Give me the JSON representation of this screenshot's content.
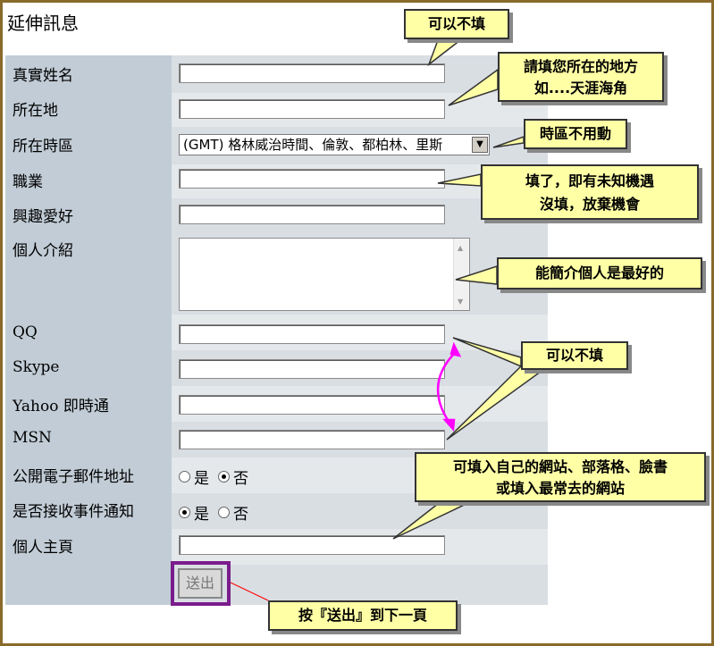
{
  "page": {
    "title": "延伸訊息"
  },
  "fields": [
    {
      "label": "真實姓名",
      "value": ""
    },
    {
      "label": "所在地",
      "value": ""
    },
    {
      "label": "所在時區",
      "value": "(GMT) 格林威治時間、倫敦、都柏林、里斯"
    },
    {
      "label": "職業",
      "value": ""
    },
    {
      "label": "興趣愛好",
      "value": ""
    },
    {
      "label": "個人介紹",
      "value": ""
    },
    {
      "label": "QQ",
      "value": ""
    },
    {
      "label": "Skype",
      "value": ""
    },
    {
      "label": "Yahoo 即時通",
      "value": ""
    },
    {
      "label": "MSN",
      "value": ""
    },
    {
      "label": "公開電子郵件地址",
      "options": [
        "是",
        "否"
      ],
      "selected": "否"
    },
    {
      "label": "是否接收事件通知",
      "options": [
        "是",
        "否"
      ],
      "selected": "是"
    },
    {
      "label": "個人主頁",
      "value": ""
    }
  ],
  "submit": {
    "label": "送出"
  },
  "notes": {
    "optional_top": "可以不填",
    "location_line1": "請填您所在的地方",
    "location_line2": "如....天涯海角",
    "timezone": "時區不用動",
    "job_line1": "填了，即有未知機遇",
    "job_line2": "沒填，放棄機會",
    "intro": "能簡介個人是最好的",
    "optional_im": "可以不填",
    "homepage_line1": "可填入自己的網站、部落格、臉書",
    "homepage_line2": "或填入最常去的網站",
    "submit_hint": "按『送出』到下一頁"
  },
  "colors": {
    "label_column": "#c1ccd6",
    "note_bg": "#ffffa6",
    "submit_border": "#7a1c8c",
    "im_arrow": "#ff00ff",
    "frame_border": "#8a6a2a"
  }
}
